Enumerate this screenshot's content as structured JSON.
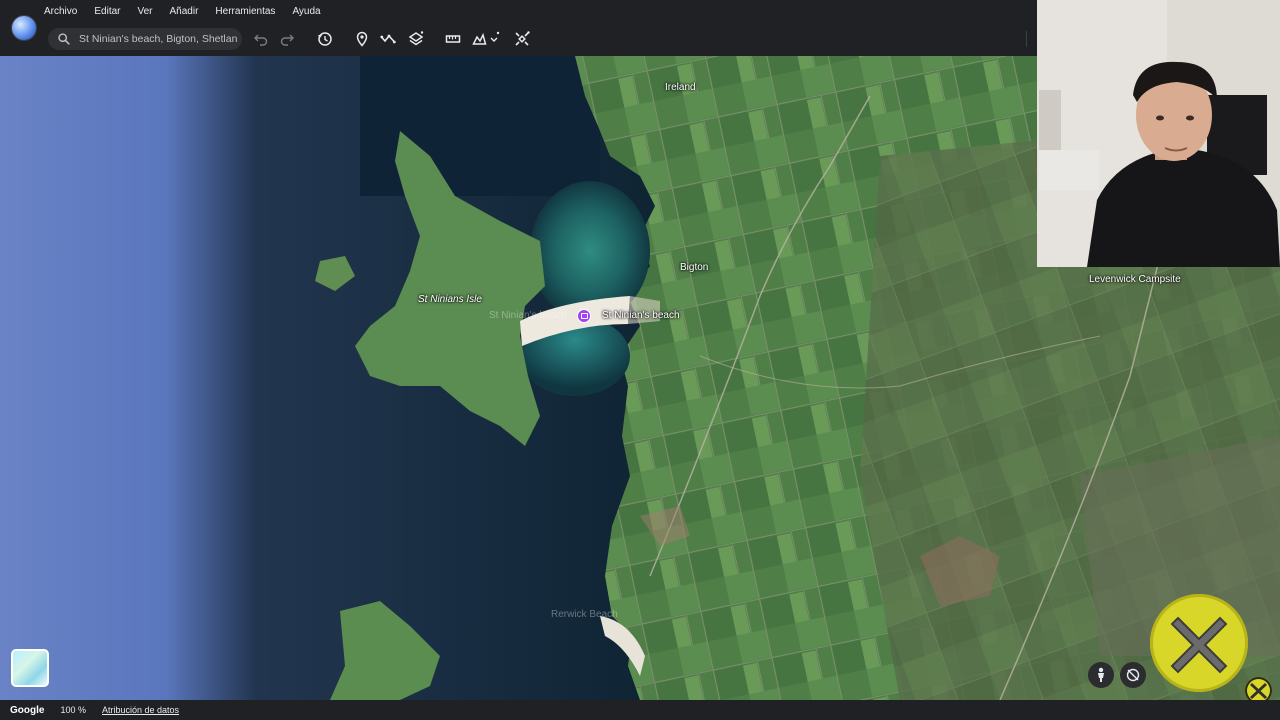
{
  "menu": {
    "items": [
      "Archivo",
      "Editar",
      "Ver",
      "Añadir",
      "Herramientas",
      "Ayuda"
    ]
  },
  "search": {
    "value": "St Ninian's beach, Bigton, Shetland"
  },
  "toolbar": {
    "icons": [
      "undo-icon",
      "redo-icon",
      "history-icon",
      "placemark-icon",
      "path-icon",
      "layers-icon",
      "ruler-icon",
      "elevation-icon",
      "satellite-icon"
    ]
  },
  "map": {
    "labels": {
      "ireland": "Ireland",
      "bigton": "Bigton",
      "isle": "St Ninians Isle",
      "beach": "St Ninian's beach",
      "beach_ghost": "St Ninian's beach",
      "campsite": "Levenwick Campsite",
      "ghost_south": "Rerwick Beach"
    }
  },
  "bottom": {
    "brand": "Google",
    "zoom": "100 %",
    "attribution": "Atribución de datos"
  },
  "colors": {
    "menubar": "#202124",
    "pin": "#a142f4",
    "overlay_x": "#d9d62a"
  }
}
